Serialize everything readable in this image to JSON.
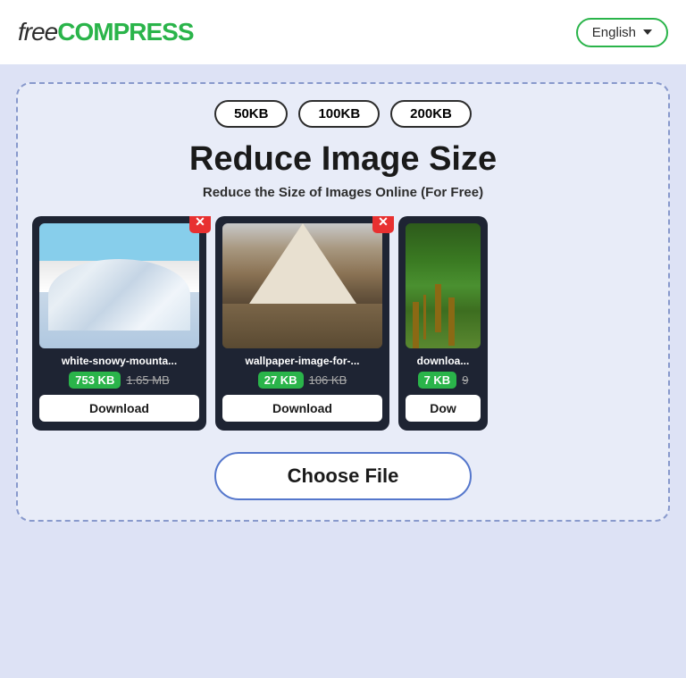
{
  "header": {
    "logo_free": "free",
    "logo_compress": "COMPRESS",
    "language_label": "English",
    "chevron_icon": "chevron-down-icon"
  },
  "main": {
    "size_buttons": [
      {
        "label": "50KB"
      },
      {
        "label": "100KB"
      },
      {
        "label": "200KB"
      }
    ],
    "title": "Reduce Image Size",
    "subtitle": "Reduce the Size of Images Online (For Free)",
    "cards": [
      {
        "filename": "white-snowy-mounta...",
        "compressed_size": "753 KB",
        "original_size": "1.65 MB",
        "download_label": "Download",
        "type": "snowy"
      },
      {
        "filename": "wallpaper-image-for-...",
        "compressed_size": "27 KB",
        "original_size": "106 KB",
        "download_label": "Download",
        "type": "mountain"
      },
      {
        "filename": "downloa...",
        "compressed_size": "7 KB",
        "original_size": "9",
        "download_label": "Dow",
        "type": "forest"
      }
    ],
    "choose_file_label": "Choose File"
  }
}
